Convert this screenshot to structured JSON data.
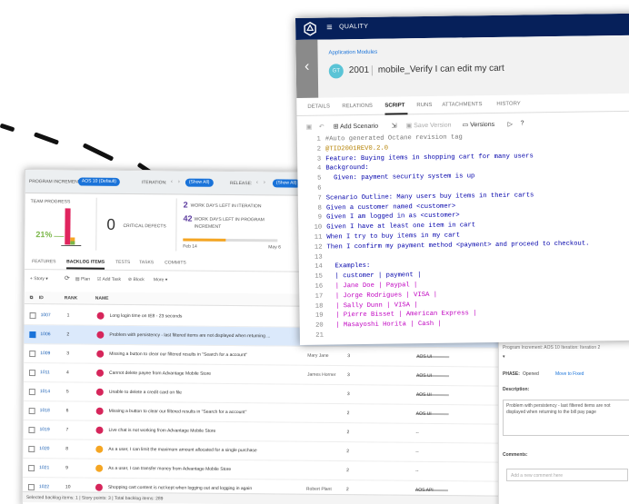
{
  "back_window": {
    "topbar": {
      "program_increment_label": "PROGRAM INCREMENT:",
      "program_increment_value": "AOS 10 (Default)",
      "iteration_label": "ITERATION:",
      "iteration_value": "(Show All)",
      "release_label": "RELEASE:",
      "release_value": "(Show All)"
    },
    "team_progress": {
      "title": "TEAM PROGRESS",
      "percent": "21%"
    },
    "critical_defects": {
      "count": "0",
      "label": "CRITICAL DEFECTS"
    },
    "iteration_days": {
      "count": "2",
      "label": "WORK DAYS LEFT IN ITERATION"
    },
    "program_days": {
      "count": "42",
      "label": "WORK DAYS LEFT IN PROGRAM INCREMENT"
    },
    "timeline": {
      "start": "Feb 14",
      "end": "May 6",
      "progress": 0.45
    },
    "tabs": [
      "FEATURES",
      "BACKLOG ITEMS",
      "TESTS",
      "TASKS",
      "COMMITS"
    ],
    "active_tab": "BACKLOG ITEMS",
    "toolbar": {
      "story": "Story",
      "plan": "Plan",
      "add_task": "Add Task",
      "block": "Block",
      "more": "More"
    },
    "columns": {
      "id": "ID",
      "rank": "RANK",
      "name": "NAME"
    },
    "rows": [
      {
        "id": "1007",
        "rank": "1",
        "name": "Long login time on IE8 - 23 seconds",
        "type": "defect",
        "owner": "",
        "points": "",
        "release": "",
        "selected": false
      },
      {
        "id": "1006",
        "rank": "2",
        "name": "Problem with persistency - last filtered items are not displayed when returning ...",
        "type": "defect",
        "owner": "",
        "points": "",
        "release": "",
        "selected": true
      },
      {
        "id": "1009",
        "rank": "3",
        "name": "Missing a button to clear our filtered results in \"Search for a account\"",
        "type": "defect",
        "owner": "Mary Jane",
        "points": "3",
        "release": "AOS UI",
        "selected": false
      },
      {
        "id": "1011",
        "rank": "4",
        "name": "Cannot delete payee from Advantage Mobile Store",
        "type": "defect",
        "owner": "James Horner",
        "points": "3",
        "release": "AOS UI",
        "selected": false
      },
      {
        "id": "1014",
        "rank": "5",
        "name": "Unable to delete a credit card on file",
        "type": "defect",
        "owner": "",
        "points": "3",
        "release": "AOS UI",
        "selected": false
      },
      {
        "id": "1018",
        "rank": "6",
        "name": "Missing a button to clear our filtered results in \"Search for a account\"",
        "type": "defect",
        "owner": "",
        "points": "2",
        "release": "AOS UI",
        "selected": false
      },
      {
        "id": "1019",
        "rank": "7",
        "name": "Live chat is not working from Advantage Mobile Store",
        "type": "defect",
        "owner": "",
        "points": "2",
        "release": "--",
        "selected": false
      },
      {
        "id": "1020",
        "rank": "8",
        "name": "As a user, I can limit the maximum amount allocated for a single purchase",
        "type": "story",
        "owner": "",
        "points": "2",
        "release": "--",
        "selected": false
      },
      {
        "id": "1021",
        "rank": "9",
        "name": "As a user, I can transfer money from Advantage Mobile Store",
        "type": "story",
        "owner": "",
        "points": "2",
        "release": "--",
        "selected": false
      },
      {
        "id": "1022",
        "rank": "10",
        "name": "Shopping cart content is not kept when logging out and logging in again",
        "type": "defect",
        "owner": "Robert Plant",
        "points": "2",
        "release": "AOS API",
        "selected": false
      }
    ],
    "status_bar": "Selected backlog items: 1 | Story points: 3 | Total backlog items: 289",
    "detail": {
      "meta": "Program Increment: AOS 10    Iteration: Iteration 2",
      "phase_label": "PHASE:",
      "phase_value": "Opened",
      "move_label": "Move to Fixed",
      "description_label": "Description:",
      "description": "Problem with persistency - last filtered items are not displayed when returning to the bill pay page",
      "comments_label": "Comments:",
      "comment_placeholder": "Add a new comment here"
    }
  },
  "front_window": {
    "app_title": "QUALITY",
    "module": "Application Modules",
    "badge": "GT",
    "item_id": "2001",
    "item_name": "mobile_Verify I can edit my cart",
    "tabs": [
      "DETAILS",
      "RELATIONS",
      "SCRIPT",
      "RUNS",
      "ATTACHMENTS",
      "HISTORY"
    ],
    "active_tab": "SCRIPT",
    "toolbar": {
      "add_scenario": "Add Scenario",
      "save_version": "Save Version",
      "versions": "Versions"
    },
    "script_lines": [
      "#Auto generated Octane revision tag",
      "@TID2001REV0.2.0",
      "Feature: Buying items in shopping cart for many users",
      "Background:",
      "  Given: payment security system is up",
      "",
      "Scenario Outline: Many users buy items in their carts",
      "Given a customer named <customer>",
      "Given I am logged in as <customer>",
      "Given I have at least one item in cart",
      "When I try to buy items in my cart",
      "Then I confirm my payment method <payment> and proceed to checkout.",
      "",
      "  Examples:",
      "  | customer | payment |",
      "  | Jane Doe | Paypal |",
      "  | Jorge Rodrigues | VISA |",
      "  | Sally Dunn | VISA |",
      "  | Pierre Bisset | American Express |",
      "  | Masayoshi Horita | Cash |",
      ""
    ]
  }
}
